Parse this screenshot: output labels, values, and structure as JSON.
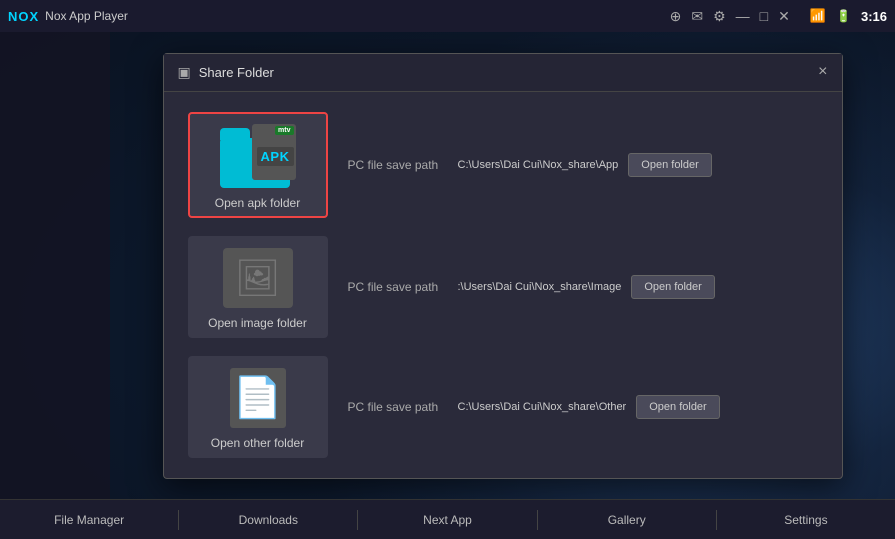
{
  "titlebar": {
    "logo": "NOX",
    "title": "Nox App Player",
    "icons": [
      "pin",
      "mail",
      "settings",
      "minimize",
      "maximize",
      "close"
    ],
    "time": "3:16"
  },
  "modal": {
    "title": "Share Folder",
    "close_label": "×",
    "title_icon": "□"
  },
  "folders": [
    {
      "id": "apk",
      "label": "Open apk folder",
      "selected": true,
      "path_label": "PC file save path",
      "path_value": "C:\\Users\\Dai Cui\\Nox_share\\App",
      "open_btn_label": "Open folder"
    },
    {
      "id": "image",
      "label": "Open image folder",
      "selected": false,
      "path_label": "PC file save path",
      "path_value": ":\\Users\\Dai Cui\\Nox_share\\Image",
      "open_btn_label": "Open folder"
    },
    {
      "id": "other",
      "label": "Open other folder",
      "selected": false,
      "path_label": "PC file save path",
      "path_value": "C:\\Users\\Dai Cui\\Nox_share\\Other",
      "open_btn_label": "Open folder"
    }
  ],
  "taskbar": {
    "items": [
      "File Manager",
      "Downloads",
      "Next App",
      "Gallery",
      "Settings"
    ]
  }
}
